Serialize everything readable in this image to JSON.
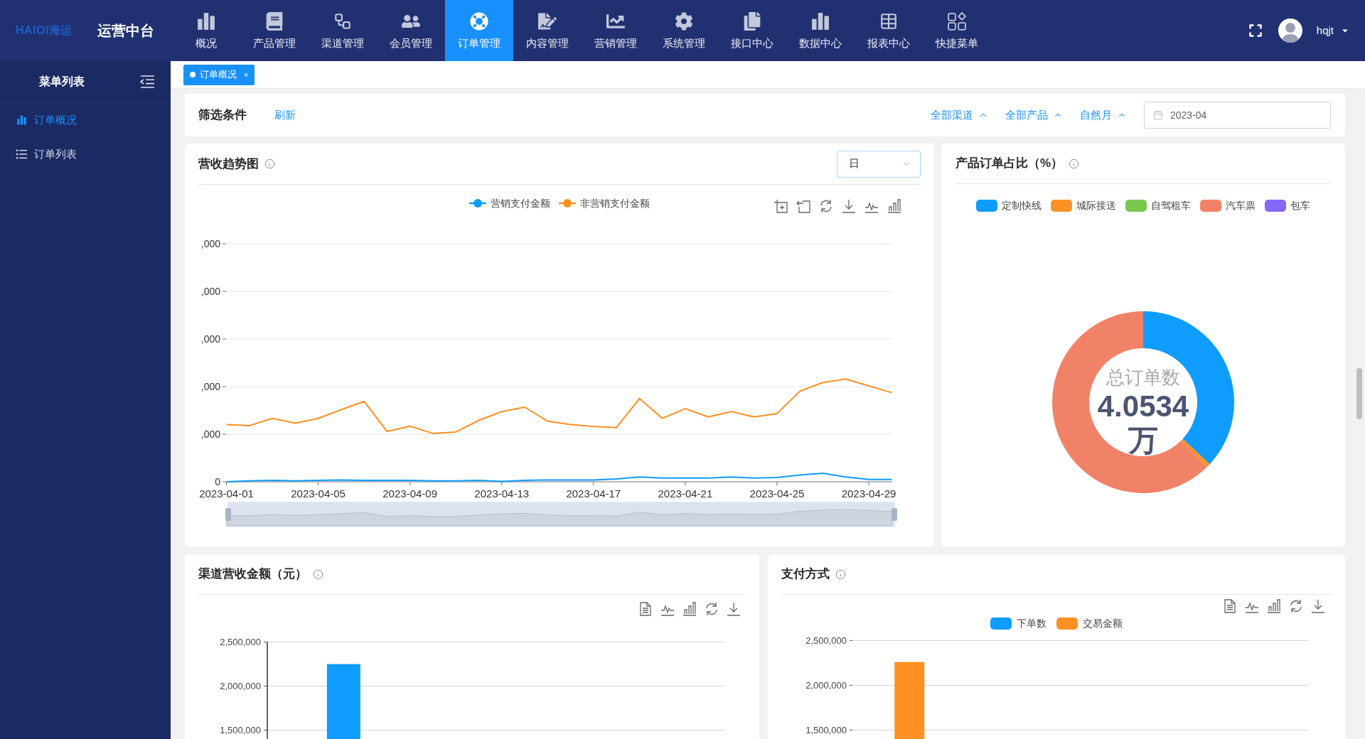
{
  "header": {
    "logo": "HAIOI海运",
    "title": "运营中台",
    "nav": [
      {
        "label": "概况",
        "selected": false
      },
      {
        "label": "产品管理",
        "selected": false
      },
      {
        "label": "渠道管理",
        "selected": false
      },
      {
        "label": "会员管理",
        "selected": false
      },
      {
        "label": "订单管理",
        "selected": true
      },
      {
        "label": "内容管理",
        "selected": false
      },
      {
        "label": "营销管理",
        "selected": false
      },
      {
        "label": "系统管理",
        "selected": false
      },
      {
        "label": "接口中心",
        "selected": false
      },
      {
        "label": "数据中心",
        "selected": false
      },
      {
        "label": "报表中心",
        "selected": false
      },
      {
        "label": "快捷菜单",
        "selected": false
      }
    ],
    "user": {
      "name": "hqjt"
    }
  },
  "sidebar": {
    "title": "菜单列表",
    "items": [
      {
        "label": "订单概况",
        "selected": true
      },
      {
        "label": "订单列表",
        "selected": false
      }
    ]
  },
  "tabs": [
    {
      "label": "订单概况",
      "selected": true,
      "close": "×"
    }
  ],
  "filter": {
    "title": "筛选条件",
    "refresh": "刷新",
    "dropdowns": [
      {
        "label": "全部渠道"
      },
      {
        "label": "全部产品"
      },
      {
        "label": "自然月"
      }
    ],
    "date": {
      "value": "2023-04"
    }
  },
  "revenue_trend": {
    "title": "营收趋势图",
    "period": {
      "value": "日"
    },
    "legend": [
      {
        "label": "营销支付金额",
        "color": "#0e9cff"
      },
      {
        "label": "非营销支付金额",
        "color": "#ff9124"
      }
    ],
    "y_axis_labels": [
      ",000",
      ",000",
      ",000",
      ",000",
      ",000",
      "0"
    ],
    "x_axis_labels": [
      "2023-04-01",
      "2023-04-05",
      "2023-04-09",
      "2023-04-13",
      "2023-04-17",
      "2023-04-21",
      "2023-04-25",
      "2023-04-29"
    ],
    "range_slider": {
      "level": 1
    }
  },
  "product_share": {
    "title": "产品订单占比（%）",
    "legend": [
      {
        "label": "定制快线",
        "color": "#0e9cff"
      },
      {
        "label": "城际接送",
        "color": "#ff9124"
      },
      {
        "label": "自驾租车",
        "color": "#79c74f"
      },
      {
        "label": "汽车票",
        "color": "#f28267"
      },
      {
        "label": "包车",
        "color": "#8467f4"
      }
    ],
    "center_label": "总订单数",
    "center_value": "4.0534万"
  },
  "channel_revenue": {
    "title": "渠道营收金额（元）",
    "chart_data": {
      "type": "bar",
      "series": [
        {
          "color": "#0e9cff",
          "values": [
            2250000,
            null,
            null
          ]
        }
      ],
      "ylim": [
        1400000,
        2500000
      ],
      "yticks": [
        {
          "value": 1500000,
          "label": "1,500,000"
        },
        {
          "value": 2000000,
          "label": "2,000,000"
        },
        {
          "value": 2500000,
          "label": "2,500,000"
        }
      ]
    }
  },
  "payment_method": {
    "title": "支付方式",
    "chart_data": {
      "type": "bar",
      "series": [
        {
          "name": "下单数",
          "color": "#0e9cff",
          "values": [
            null,
            null,
            null,
            null
          ]
        },
        {
          "name": "交易金额",
          "color": "#ff9124",
          "values": [
            2260000,
            null,
            null,
            null
          ]
        }
      ],
      "ylim": [
        1400000,
        2500000
      ],
      "yticks": [
        {
          "value": 1500000,
          "label": "1,500,000"
        },
        {
          "value": 2000000,
          "label": "2,000,000"
        },
        {
          "value": 2500000,
          "label": "2,500,000"
        }
      ]
    }
  }
}
